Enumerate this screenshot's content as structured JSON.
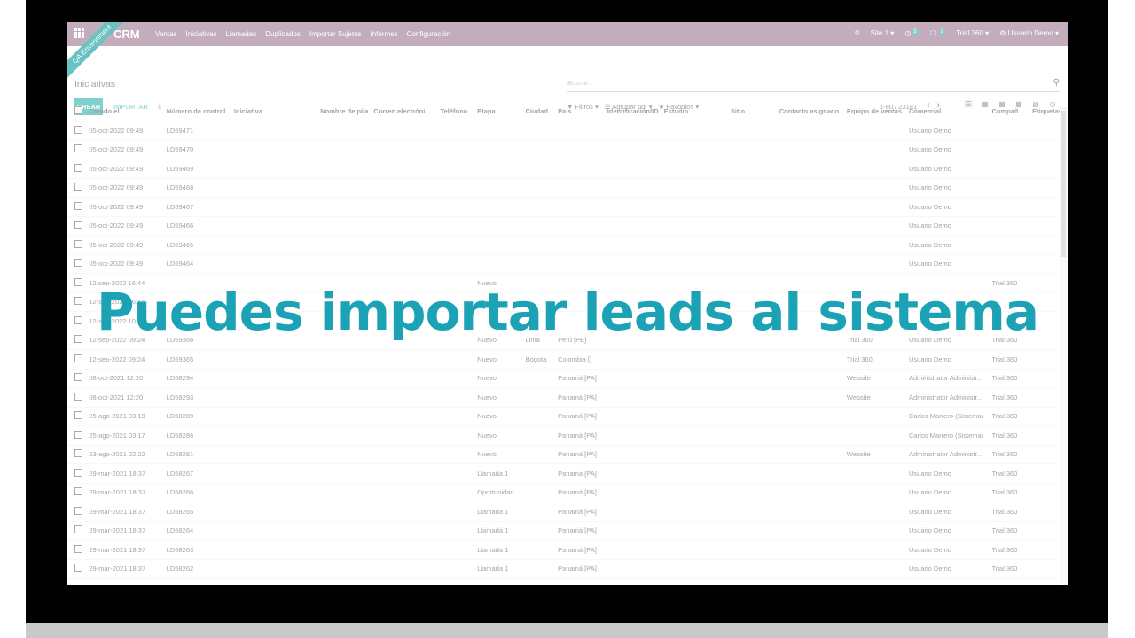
{
  "navbar": {
    "app_name": "CRM",
    "menu": [
      "Ventas",
      "Iniciativas",
      "Llamadas",
      "Duplicados",
      "Importar Sujetos",
      "Informes",
      "Configuración"
    ],
    "site_label": "Site 1",
    "activity_count": "3",
    "message_count": "2",
    "company": "Trial 360",
    "user": "Usuario Demo",
    "ribbon": "QA Environment"
  },
  "control_panel": {
    "breadcrumb": "Iniciativas",
    "search_placeholder": "Buscar...",
    "create_label": "CREAR",
    "import_label": "IMPORTAR",
    "filters_label": "Filtros",
    "groupby_label": "Agrupar por",
    "favorites_label": "Favoritos",
    "pager": "1-80 / 23181"
  },
  "table": {
    "columns": [
      "Creado el",
      "Número de control",
      "Iniciativa",
      "Nombre de pila",
      "Correo electróni...",
      "Teléfono",
      "Etapa",
      "Ciudad",
      "País",
      "Identificación/ID",
      "Estudio",
      "Sitio",
      "Contacto asignado",
      "Equipo de ventas",
      "Comercial",
      "Compañ...",
      "Etiquetas"
    ],
    "rows": [
      {
        "created": "05-oct-2022 09:49",
        "control": "LD59471",
        "stage": "",
        "city": "",
        "country": "",
        "team": "",
        "salesperson": "Usuario Demo",
        "company": ""
      },
      {
        "created": "05-oct-2022 09:49",
        "control": "LD59470",
        "stage": "",
        "city": "",
        "country": "",
        "team": "",
        "salesperson": "Usuario Demo",
        "company": ""
      },
      {
        "created": "05-oct-2022 09:49",
        "control": "LD59469",
        "stage": "",
        "city": "",
        "country": "",
        "team": "",
        "salesperson": "Usuario Demo",
        "company": ""
      },
      {
        "created": "05-oct-2022 09:49",
        "control": "LD59468",
        "stage": "",
        "city": "",
        "country": "",
        "team": "",
        "salesperson": "Usuario Demo",
        "company": ""
      },
      {
        "created": "05-oct-2022 09:49",
        "control": "LD59467",
        "stage": "",
        "city": "",
        "country": "",
        "team": "",
        "salesperson": "Usuario Demo",
        "company": ""
      },
      {
        "created": "05-oct-2022 09:49",
        "control": "LD59466",
        "stage": "",
        "city": "",
        "country": "",
        "team": "",
        "salesperson": "Usuario Demo",
        "company": ""
      },
      {
        "created": "05-oct-2022 09:49",
        "control": "LD59465",
        "stage": "",
        "city": "",
        "country": "",
        "team": "",
        "salesperson": "Usuario Demo",
        "company": ""
      },
      {
        "created": "05-oct-2022 09:49",
        "control": "LD59464",
        "stage": "",
        "city": "",
        "country": "",
        "team": "",
        "salesperson": "Usuario Demo",
        "company": ""
      },
      {
        "created": "12-sep-2022 16:44",
        "control": "",
        "stage": "Nuevo",
        "city": "",
        "country": "",
        "team": "",
        "salesperson": "",
        "company": "Trial 360"
      },
      {
        "created": "12-sep-2022 16:44",
        "control": "",
        "stage": "",
        "city": "",
        "country": "",
        "team": "",
        "salesperson": "",
        "company": ""
      },
      {
        "created": "12-sep-2022 10:5",
        "control": "",
        "stage": "",
        "city": "",
        "country": "",
        "team": "",
        "salesperson": "",
        "company": ""
      },
      {
        "created": "12-sep-2022 09:24",
        "control": "LD59366",
        "stage": "Nuevo",
        "city": "Lima",
        "country": "Perú [PE]",
        "team": "Trial 360",
        "salesperson": "Usuario Demo",
        "company": "Trial 360"
      },
      {
        "created": "12-sep-2022 09:24",
        "control": "LD59365",
        "stage": "Nuevo",
        "city": "Bogota",
        "country": "Colombia []",
        "team": "Trial 360",
        "salesperson": "Usuario Demo",
        "company": "Trial 360"
      },
      {
        "created": "08-oct-2021 12:20",
        "control": "LD58294",
        "stage": "Nuevo",
        "city": "",
        "country": "Panamá [PA]",
        "team": "Website",
        "salesperson": "Administrator Administr...",
        "company": "Trial 360"
      },
      {
        "created": "08-oct-2021 12:20",
        "control": "LD58293",
        "stage": "Nuevo",
        "city": "",
        "country": "Panamá [PA]",
        "team": "Website",
        "salesperson": "Administrator Administr...",
        "company": "Trial 360"
      },
      {
        "created": "25-ago-2021 03:19",
        "control": "LD58289",
        "stage": "Nuevo",
        "city": "",
        "country": "Panamá [PA]",
        "team": "",
        "salesperson": "Carlos Marrero (Sistema)",
        "company": "Trial 360"
      },
      {
        "created": "25-ago-2021 03:17",
        "control": "LD58286",
        "stage": "Nuevo",
        "city": "",
        "country": "Panamá [PA]",
        "team": "",
        "salesperson": "Carlos Marrero (Sistema)",
        "company": "Trial 360"
      },
      {
        "created": "23-ago-2021 22:22",
        "control": "LD58281",
        "stage": "Nuevo",
        "city": "",
        "country": "Panamá [PA]",
        "team": "Website",
        "salesperson": "Administrator Administr...",
        "company": "Trial 360"
      },
      {
        "created": "29-mar-2021 18:37",
        "control": "LD58267",
        "stage": "Llamada 1",
        "city": "",
        "country": "Panamá [PA]",
        "team": "",
        "salesperson": "Usuario Demo",
        "company": "Trial 360"
      },
      {
        "created": "29-mar-2021 18:37",
        "control": "LD58266",
        "stage": "Oportunidad...",
        "city": "",
        "country": "Panamá [PA]",
        "team": "",
        "salesperson": "Usuario Demo",
        "company": "Trial 360"
      },
      {
        "created": "29-mar-2021 18:37",
        "control": "LD58265",
        "stage": "Llamada 1",
        "city": "",
        "country": "Panamá [PA]",
        "team": "",
        "salesperson": "Usuario Demo",
        "company": "Trial 360"
      },
      {
        "created": "29-mar-2021 18:37",
        "control": "LD58264",
        "stage": "Llamada 1",
        "city": "",
        "country": "Panamá [PA]",
        "team": "",
        "salesperson": "Usuario Demo",
        "company": "Trial 360"
      },
      {
        "created": "29-mar-2021 18:37",
        "control": "LD58263",
        "stage": "Llamada 1",
        "city": "",
        "country": "Panamá [PA]",
        "team": "",
        "salesperson": "Usuario Demo",
        "company": "Trial 360"
      },
      {
        "created": "29-mar-2021 18:37",
        "control": "LD58262",
        "stage": "Llamada 1",
        "city": "",
        "country": "Panamá [PA]",
        "team": "",
        "salesperson": "Usuario Demo",
        "company": "Trial 360"
      }
    ]
  },
  "overlay_text": "Puedes importar leads al sistema",
  "colors": {
    "navbar": "#875a7b",
    "accent": "#00a09d",
    "headline": "#1ba3b5"
  }
}
